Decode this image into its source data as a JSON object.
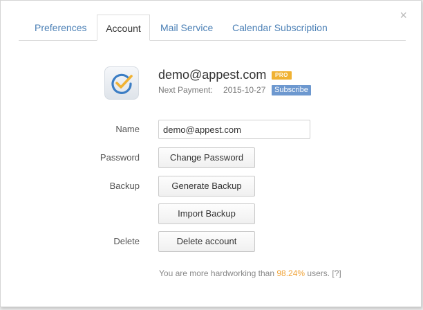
{
  "tabs": [
    {
      "label": "Preferences",
      "active": false
    },
    {
      "label": "Account",
      "active": true
    },
    {
      "label": "Mail Service",
      "active": false
    },
    {
      "label": "Calendar Subscription",
      "active": false
    }
  ],
  "close_icon": "×",
  "account": {
    "email": "demo@appest.com",
    "plan_badge": "PRO",
    "next_payment_label": "Next Payment:",
    "next_payment_date": "2015-10-27",
    "subscribe_label": "Subscribe"
  },
  "form": {
    "name_label": "Name",
    "name_value": "demo@appest.com",
    "password_label": "Password",
    "change_password_button": "Change Password",
    "backup_label": "Backup",
    "generate_backup_button": "Generate Backup",
    "import_backup_button": "Import Backup",
    "delete_label": "Delete",
    "delete_account_button": "Delete account"
  },
  "stats": {
    "prefix": "You are more hardworking than",
    "percent": "98.24%",
    "suffix": "users.",
    "help": "[?]"
  },
  "colors": {
    "tab_link": "#4a7fb5",
    "pro_badge": "#f0b233",
    "subscribe_badge": "#6d98cf",
    "percent_highlight": "#f0a43a",
    "logo_check": "#f0b233",
    "logo_circle": "#3b7dc4"
  },
  "icons": {
    "logo": "checkmark-circle-icon",
    "close": "close-icon"
  }
}
